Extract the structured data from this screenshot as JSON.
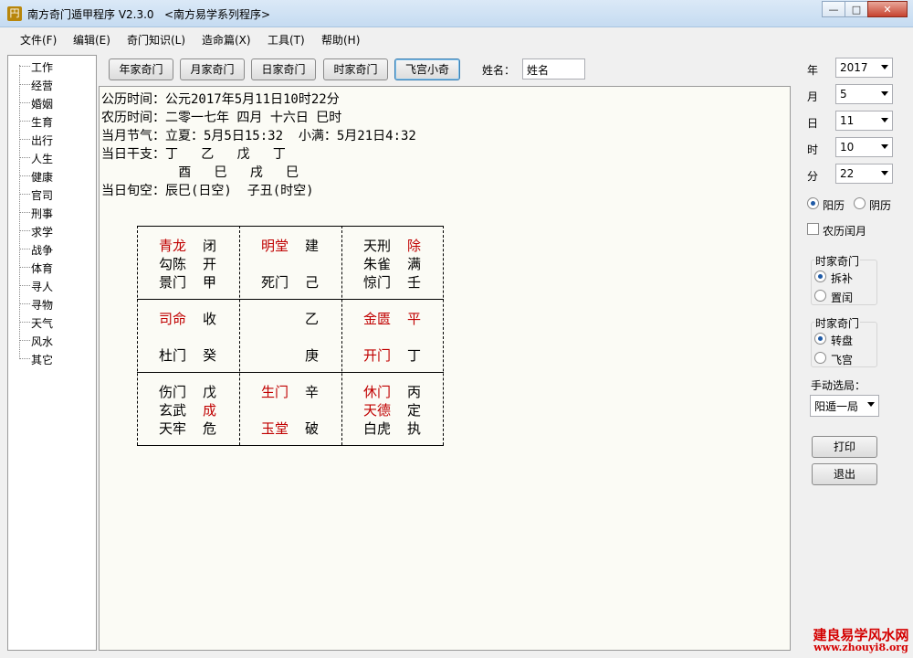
{
  "window": {
    "icon_glyph": "円",
    "title": "南方奇门遁甲程序 V2.3.0   <南方易学系列程序>",
    "minimize": "▭",
    "maximize": "□",
    "close": "✕"
  },
  "menu": [
    "文件(F)",
    "编辑(E)",
    "奇门知识(L)",
    "造命篇(X)",
    "工具(T)",
    "帮助(H)"
  ],
  "tree": [
    "工作",
    "经营",
    "婚姻",
    "生育",
    "出行",
    "人生",
    "健康",
    "官司",
    "刑事",
    "求学",
    "战争",
    "体育",
    "寻人",
    "寻物",
    "天气",
    "风水",
    "其它"
  ],
  "toolbar": {
    "buttons": [
      "年家奇门",
      "月家奇门",
      "日家奇门",
      "时家奇门",
      "飞宫小奇"
    ],
    "name_label": "姓名：",
    "name_value": "姓名"
  },
  "info": {
    "line1": "公历时间：公元2017年5月11日10时22分",
    "line2": "农历时间：二零一七年 四月 十六日 巳时",
    "line3": "当月节气：立夏：5月5日15:32  小满：5月21日4:32",
    "line4": "当日干支：丁   乙   戊   丁",
    "line5": "          酉   巳   戌   巳",
    "line6": "当日旬空：辰巳(日空)  子丑(时空)"
  },
  "palaces": {
    "p1": {
      "r1a": "青龙",
      "r1b": "闭",
      "r2a": "勾陈",
      "r2b": "开",
      "r3a": "景门",
      "r3b": "甲"
    },
    "p2": {
      "r1a": "明堂",
      "r1b": "建",
      "r3a": "死门",
      "r3b": "己"
    },
    "p3": {
      "r1a": "天刑",
      "r1b": "除",
      "r2a": "朱雀",
      "r2b": "满",
      "r3a": "惊门",
      "r3b": "壬"
    },
    "p4": {
      "r1a": "司命",
      "r1b": "收",
      "r3a": "杜门",
      "r3b": "癸"
    },
    "p5": {
      "r1b": "乙",
      "r3b": "庚"
    },
    "p6": {
      "r1a": "金匮",
      "r1b": "平",
      "r3a": "开门",
      "r3b": "丁"
    },
    "p7": {
      "r1a": "伤门",
      "r1b": "戊",
      "r2a": "玄武",
      "r2b": "成",
      "r3a": "天牢",
      "r3b": "危"
    },
    "p8": {
      "r1a": "生门",
      "r1b": "辛",
      "r3a": "玉堂",
      "r3b": "破"
    },
    "p9": {
      "r1a": "休门",
      "r1b": "丙",
      "r2a": "天德",
      "r2b": "定",
      "r3a": "白虎",
      "r3b": "执"
    }
  },
  "right": {
    "year_label": "年",
    "year": "2017",
    "month_label": "月",
    "month": "5",
    "day_label": "日",
    "day": "11",
    "hour_label": "时",
    "hour": "10",
    "minute_label": "分",
    "minute": "22",
    "solar": "阳历",
    "lunar": "阴历",
    "leap_month": "农历闰月",
    "group1_title": "时家奇门",
    "g1_opt1": "拆补",
    "g1_opt2": "置闰",
    "group2_title": "时家奇门",
    "g2_opt1": "转盘",
    "g2_opt2": "飞宫",
    "manual_label": "手动选局：",
    "manual_value": "阳遁一局",
    "print": "打印",
    "exit": "退出"
  },
  "watermark": {
    "line1": "建良易学风水网",
    "line2": "www.zhouyi8.org"
  }
}
